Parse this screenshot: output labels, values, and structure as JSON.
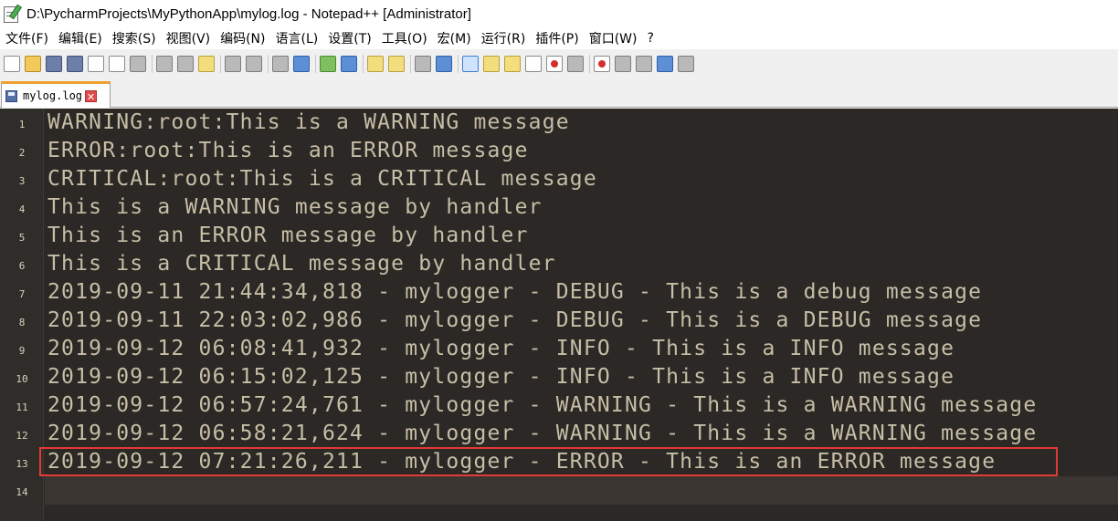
{
  "window": {
    "title": "D:\\PycharmProjects\\MyPythonApp\\mylog.log - Notepad++ [Administrator]"
  },
  "menu": [
    "文件(F)",
    "编辑(E)",
    "搜索(S)",
    "视图(V)",
    "编码(N)",
    "语言(L)",
    "设置(T)",
    "工具(O)",
    "宏(M)",
    "运行(R)",
    "插件(P)",
    "窗口(W)",
    "?"
  ],
  "toolbar": {
    "icons": [
      "new-file-icon",
      "open-file-icon",
      "save-icon",
      "save-all-icon",
      "close-icon",
      "close-all-icon",
      "print-icon",
      "cut-icon",
      "copy-icon",
      "paste-icon",
      "undo-icon",
      "redo-icon",
      "find-icon",
      "replace-icon",
      "zoom-in-icon",
      "zoom-out-icon",
      "sync-vertical-icon",
      "sync-horizontal-icon",
      "word-wrap-icon",
      "show-all-characters-icon",
      "indent-guide-icon",
      "user-defined-language-icon",
      "doc-map-icon",
      "function-list-icon",
      "folder-as-workspace-icon",
      "monitoring-icon",
      "record-macro-icon",
      "stop-recording-icon",
      "play-macro-icon",
      "run-macro-multiple-icon",
      "save-macro-icon"
    ]
  },
  "tab": {
    "label": "mylog.log",
    "close_glyph": "✕"
  },
  "editor": {
    "lines": [
      {
        "num": "1",
        "text": "WARNING:root:This is a WARNING message"
      },
      {
        "num": "2",
        "text": "ERROR:root:This is an ERROR message"
      },
      {
        "num": "3",
        "text": "CRITICAL:root:This is a CRITICAL message"
      },
      {
        "num": "4",
        "text": "This is a WARNING message by handler"
      },
      {
        "num": "5",
        "text": "This is an ERROR message by handler"
      },
      {
        "num": "6",
        "text": "This is a CRITICAL message by handler"
      },
      {
        "num": "7",
        "text": "2019-09-11 21:44:34,818 - mylogger - DEBUG - This is a debug message"
      },
      {
        "num": "8",
        "text": "2019-09-11 22:03:02,986 - mylogger - DEBUG - This is a DEBUG message"
      },
      {
        "num": "9",
        "text": "2019-09-12 06:08:41,932 - mylogger - INFO - This is a INFO message"
      },
      {
        "num": "10",
        "text": "2019-09-12 06:15:02,125 - mylogger - INFO - This is a INFO message"
      },
      {
        "num": "11",
        "text": "2019-09-12 06:57:24,761 - mylogger - WARNING - This is a WARNING message"
      },
      {
        "num": "12",
        "text": "2019-09-12 06:58:21,624 - mylogger - WARNING - This is a WARNING message"
      },
      {
        "num": "13",
        "text": "2019-09-12 07:21:26,211 - mylogger - ERROR - This is an ERROR message"
      },
      {
        "num": "14",
        "text": ""
      }
    ],
    "current_line": 14,
    "highlighted_line": 13
  },
  "colors": {
    "editor_background": "#2b2825",
    "text": "#c7bea6",
    "gutter_text": "#d9d1b8",
    "highlight_box": "#e53935",
    "active_tab_accent": "#f0a030"
  }
}
